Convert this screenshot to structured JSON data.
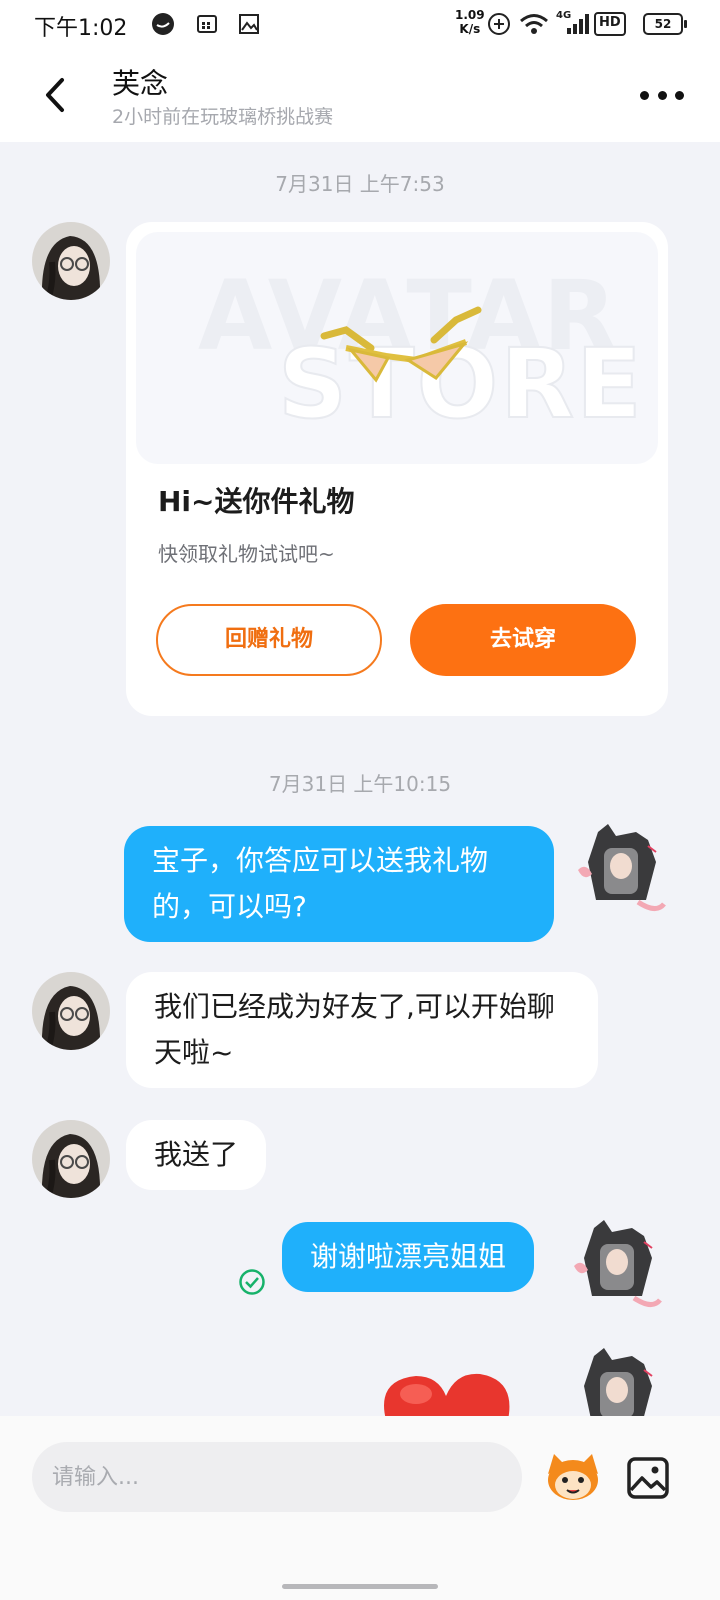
{
  "status_bar": {
    "time": "下午1:02",
    "speed_top": "1.09",
    "speed_unit": "K/s",
    "network": "4G",
    "hd": "HD",
    "battery": "52"
  },
  "header": {
    "name": "芙念",
    "status": "2小时前在玩玻璃桥挑战赛"
  },
  "messages": {
    "ts1": "7月31日 上午7:53",
    "gift": {
      "banner_line1": "AVATAR",
      "banner_line2": "STORE",
      "title": "Hi~送你件礼物",
      "subtitle": "快领取礼物试试吧~",
      "btn_return": "回赠礼物",
      "btn_try": "去试穿"
    },
    "ts2": "7月31日 上午10:15",
    "m1": "宝子，你答应可以送我礼物的，可以吗?",
    "m2": "我们已经成为好友了,可以开始聊天啦~",
    "m3": "我送了",
    "m4": "谢谢啦漂亮姐姐"
  },
  "input": {
    "placeholder": "请输入..."
  },
  "colors": {
    "accent_orange": "#fd7112",
    "bubble_blue": "#1fb0fb",
    "read_check": "#17b26a"
  }
}
